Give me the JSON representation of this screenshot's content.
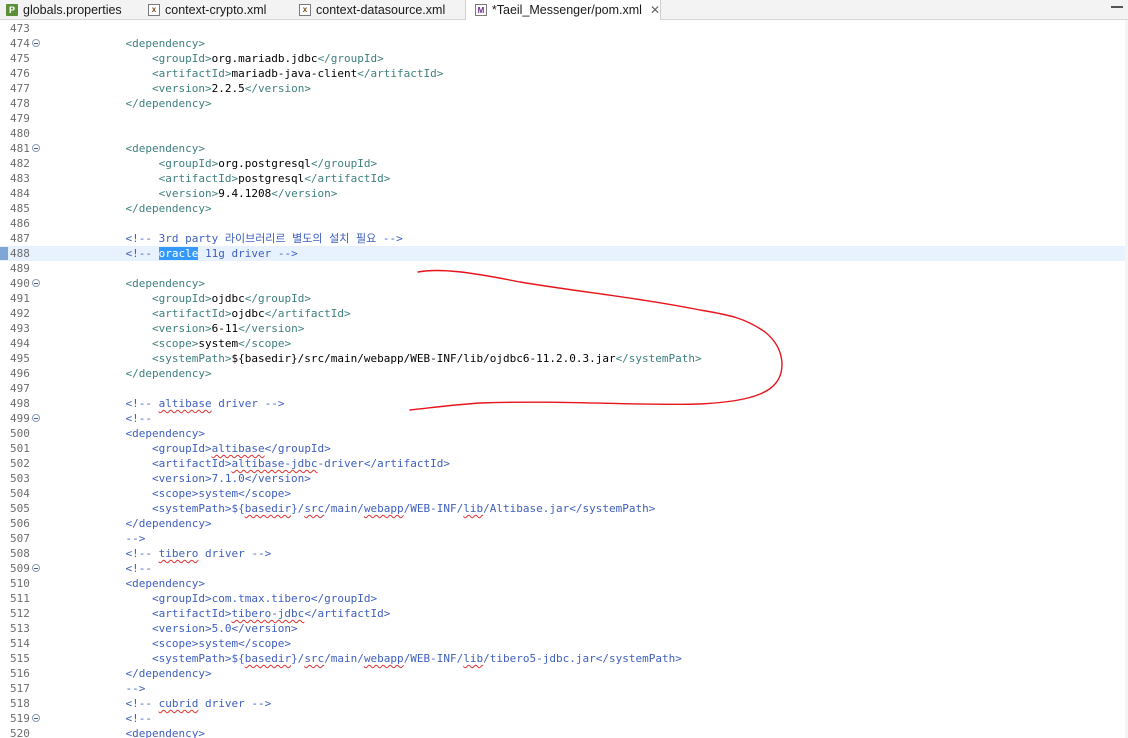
{
  "tabs": [
    {
      "label": "globals.properties",
      "icon": "properties-file-icon",
      "glyph": "P",
      "kind": "p"
    },
    {
      "label": "context-crypto.xml",
      "icon": "xml-file-icon",
      "glyph": "x",
      "kind": "x"
    },
    {
      "label": "context-datasource.xml",
      "icon": "xml-file-icon",
      "glyph": "x",
      "kind": "x"
    },
    {
      "label": "*Taeil_Messenger/pom.xml",
      "icon": "maven-pom-icon",
      "glyph": "M",
      "kind": "m",
      "active": true
    }
  ],
  "close_glyph": "✕",
  "lines": [
    {
      "n": "473",
      "parts": []
    },
    {
      "n": "474",
      "fold": true,
      "parts": [
        [
          "tag",
          "    <dependency>"
        ]
      ]
    },
    {
      "n": "475",
      "parts": [
        [
          "tag",
          "        <groupId>"
        ],
        [
          "txt",
          "org.mariadb.jdbc"
        ],
        [
          "tag",
          "</groupId>"
        ]
      ]
    },
    {
      "n": "476",
      "parts": [
        [
          "tag",
          "        <artifactId>"
        ],
        [
          "txt",
          "mariadb-java-client"
        ],
        [
          "tag",
          "</artifactId>"
        ]
      ]
    },
    {
      "n": "477",
      "parts": [
        [
          "tag",
          "        <version>"
        ],
        [
          "txt",
          "2.2.5"
        ],
        [
          "tag",
          "</version>"
        ]
      ]
    },
    {
      "n": "478",
      "parts": [
        [
          "tag",
          "    </dependency>"
        ]
      ]
    },
    {
      "n": "479",
      "parts": []
    },
    {
      "n": "480",
      "parts": []
    },
    {
      "n": "481",
      "fold": true,
      "parts": [
        [
          "tag",
          "    <dependency>"
        ]
      ]
    },
    {
      "n": "482",
      "parts": [
        [
          "tag",
          "         <groupId>"
        ],
        [
          "txt",
          "org.postgresql"
        ],
        [
          "tag",
          "</groupId>"
        ]
      ]
    },
    {
      "n": "483",
      "parts": [
        [
          "tag",
          "         <artifactId>"
        ],
        [
          "txt",
          "postgresql"
        ],
        [
          "tag",
          "</artifactId>"
        ]
      ]
    },
    {
      "n": "484",
      "parts": [
        [
          "tag",
          "         <version>"
        ],
        [
          "txt",
          "9.4.1208"
        ],
        [
          "tag",
          "</version>"
        ]
      ]
    },
    {
      "n": "485",
      "parts": [
        [
          "tag",
          "    </dependency>"
        ]
      ]
    },
    {
      "n": "486",
      "parts": []
    },
    {
      "n": "487",
      "parts": [
        [
          "cmt",
          "    <!-- 3rd party 라이브러리르 별도의 설치 필요 -->"
        ]
      ]
    },
    {
      "n": "488",
      "hl": true,
      "marker": true,
      "parts": [
        [
          "cmt",
          "    <!-- "
        ],
        [
          "sel",
          "oracle"
        ],
        [
          "cmt",
          " 11g driver -->"
        ]
      ]
    },
    {
      "n": "489",
      "parts": []
    },
    {
      "n": "490",
      "fold": true,
      "parts": [
        [
          "tag",
          "    <dependency>"
        ]
      ]
    },
    {
      "n": "491",
      "parts": [
        [
          "tag",
          "        <groupId>"
        ],
        [
          "txt",
          "ojdbc"
        ],
        [
          "tag",
          "</groupId>"
        ]
      ]
    },
    {
      "n": "492",
      "parts": [
        [
          "tag",
          "        <artifactId>"
        ],
        [
          "txt",
          "ojdbc"
        ],
        [
          "tag",
          "</artifactId>"
        ]
      ]
    },
    {
      "n": "493",
      "parts": [
        [
          "tag",
          "        <version>"
        ],
        [
          "txt",
          "6-11"
        ],
        [
          "tag",
          "</version>"
        ]
      ]
    },
    {
      "n": "494",
      "parts": [
        [
          "tag",
          "        <scope>"
        ],
        [
          "txt",
          "system"
        ],
        [
          "tag",
          "</scope>"
        ]
      ]
    },
    {
      "n": "495",
      "parts": [
        [
          "tag",
          "        <systemPath>"
        ],
        [
          "txt",
          "${basedir}/src/main/webapp/WEB-INF/lib/ojdbc6-11.2.0.3.jar"
        ],
        [
          "tag",
          "</systemPath>"
        ]
      ]
    },
    {
      "n": "496",
      "parts": [
        [
          "tag",
          "    </dependency>"
        ]
      ]
    },
    {
      "n": "497",
      "parts": []
    },
    {
      "n": "498",
      "parts": [
        [
          "cmt",
          "    <!-- "
        ],
        [
          "cmtsq",
          "altibase"
        ],
        [
          "cmt",
          " driver -->"
        ]
      ]
    },
    {
      "n": "499",
      "fold": true,
      "parts": [
        [
          "cmt",
          "    <!--"
        ]
      ]
    },
    {
      "n": "500",
      "parts": [
        [
          "cmt",
          "    <dependency>"
        ]
      ]
    },
    {
      "n": "501",
      "parts": [
        [
          "cmt",
          "        <groupId>"
        ],
        [
          "cmtsq",
          "altibase"
        ],
        [
          "cmt",
          "</groupId>"
        ]
      ]
    },
    {
      "n": "502",
      "parts": [
        [
          "cmt",
          "        <artifactId>"
        ],
        [
          "cmtsq",
          "altibase-jdbc"
        ],
        [
          "cmt",
          "-driver</artifactId>"
        ]
      ]
    },
    {
      "n": "503",
      "parts": [
        [
          "cmt",
          "        <version>7.1.0</version>"
        ]
      ]
    },
    {
      "n": "504",
      "parts": [
        [
          "cmt",
          "        <scope>system</scope>"
        ]
      ]
    },
    {
      "n": "505",
      "parts": [
        [
          "cmt",
          "        <systemPath>${"
        ],
        [
          "cmtsq",
          "basedir"
        ],
        [
          "cmt",
          "}/"
        ],
        [
          "cmtsq",
          "src"
        ],
        [
          "cmt",
          "/main/"
        ],
        [
          "cmtsq",
          "webapp"
        ],
        [
          "cmt",
          "/WEB-INF/"
        ],
        [
          "cmtsq",
          "lib"
        ],
        [
          "cmt",
          "/Altibase.jar</systemPath>"
        ]
      ]
    },
    {
      "n": "506",
      "parts": [
        [
          "cmt",
          "    </dependency>"
        ]
      ]
    },
    {
      "n": "507",
      "parts": [
        [
          "cmt",
          "    -->"
        ]
      ]
    },
    {
      "n": "508",
      "parts": [
        [
          "cmt",
          "    <!-- "
        ],
        [
          "cmtsq",
          "tibero"
        ],
        [
          "cmt",
          " driver -->"
        ]
      ]
    },
    {
      "n": "509",
      "fold": true,
      "parts": [
        [
          "cmt",
          "    <!--"
        ]
      ]
    },
    {
      "n": "510",
      "parts": [
        [
          "cmt",
          "    <dependency>"
        ]
      ]
    },
    {
      "n": "511",
      "parts": [
        [
          "cmt",
          "        <groupId>com.tmax.tibero</groupId>"
        ]
      ]
    },
    {
      "n": "512",
      "parts": [
        [
          "cmt",
          "        <artifactId>"
        ],
        [
          "cmtsq",
          "tibero-jdbc"
        ],
        [
          "cmt",
          "</artifactId>"
        ]
      ]
    },
    {
      "n": "513",
      "parts": [
        [
          "cmt",
          "        <version>5.0</version>"
        ]
      ]
    },
    {
      "n": "514",
      "parts": [
        [
          "cmt",
          "        <scope>system</scope>"
        ]
      ]
    },
    {
      "n": "515",
      "parts": [
        [
          "cmt",
          "        <systemPath>${"
        ],
        [
          "cmtsq",
          "basedir"
        ],
        [
          "cmt",
          "}/"
        ],
        [
          "cmtsq",
          "src"
        ],
        [
          "cmt",
          "/main/"
        ],
        [
          "cmtsq",
          "webapp"
        ],
        [
          "cmt",
          "/WEB-INF/"
        ],
        [
          "cmtsq",
          "lib"
        ],
        [
          "cmt",
          "/tibero5-jdbc.jar</systemPath>"
        ]
      ]
    },
    {
      "n": "516",
      "parts": [
        [
          "cmt",
          "    </dependency>"
        ]
      ]
    },
    {
      "n": "517",
      "parts": [
        [
          "cmt",
          "    -->"
        ]
      ]
    },
    {
      "n": "518",
      "parts": [
        [
          "cmt",
          "    <!-- "
        ],
        [
          "cmtsq",
          "cubrid"
        ],
        [
          "cmt",
          " driver -->"
        ]
      ]
    },
    {
      "n": "519",
      "fold": true,
      "parts": [
        [
          "cmt",
          "    <!--"
        ]
      ]
    },
    {
      "n": "520",
      "parts": [
        [
          "cmt",
          "    <dependency>"
        ]
      ]
    }
  ],
  "colors": {
    "tag": "#3f7f7f",
    "text": "#000000",
    "comment": "#3f5fbf",
    "selection": "#3399ff",
    "annotation": "#e8141c"
  }
}
